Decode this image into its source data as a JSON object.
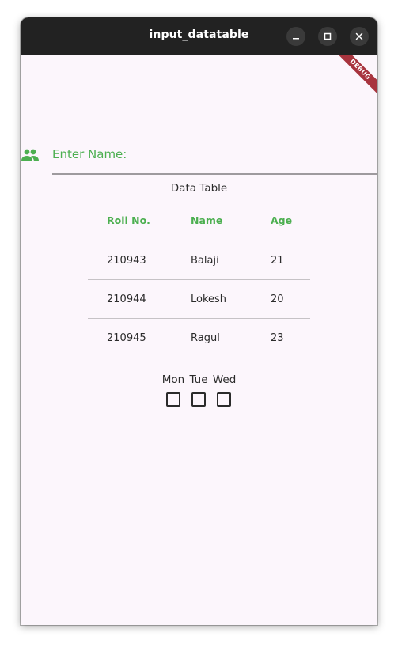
{
  "window": {
    "title": "input_datatable"
  },
  "banner": {
    "debug_label": "DEBUG"
  },
  "form": {
    "name_placeholder": "Enter Name:",
    "name_value": ""
  },
  "table": {
    "caption": "Data Table",
    "columns": [
      "Roll No.",
      "Name",
      "Age"
    ],
    "rows": [
      [
        "210943",
        "Balaji",
        "21"
      ],
      [
        "210944",
        "Lokesh",
        "20"
      ],
      [
        "210945",
        "Ragul",
        "23"
      ]
    ]
  },
  "days": {
    "labels": [
      "Mon",
      "Tue",
      "Wed"
    ],
    "checked": [
      false,
      false,
      false
    ]
  },
  "colors": {
    "accent": "#4caf50",
    "titlebar": "#222222",
    "background": "#fcf6fc",
    "debug_banner": "#a8343e"
  },
  "icons": {
    "input_prefix": "people-icon",
    "minimize": "minimize-icon",
    "maximize": "maximize-icon",
    "close": "close-icon"
  }
}
